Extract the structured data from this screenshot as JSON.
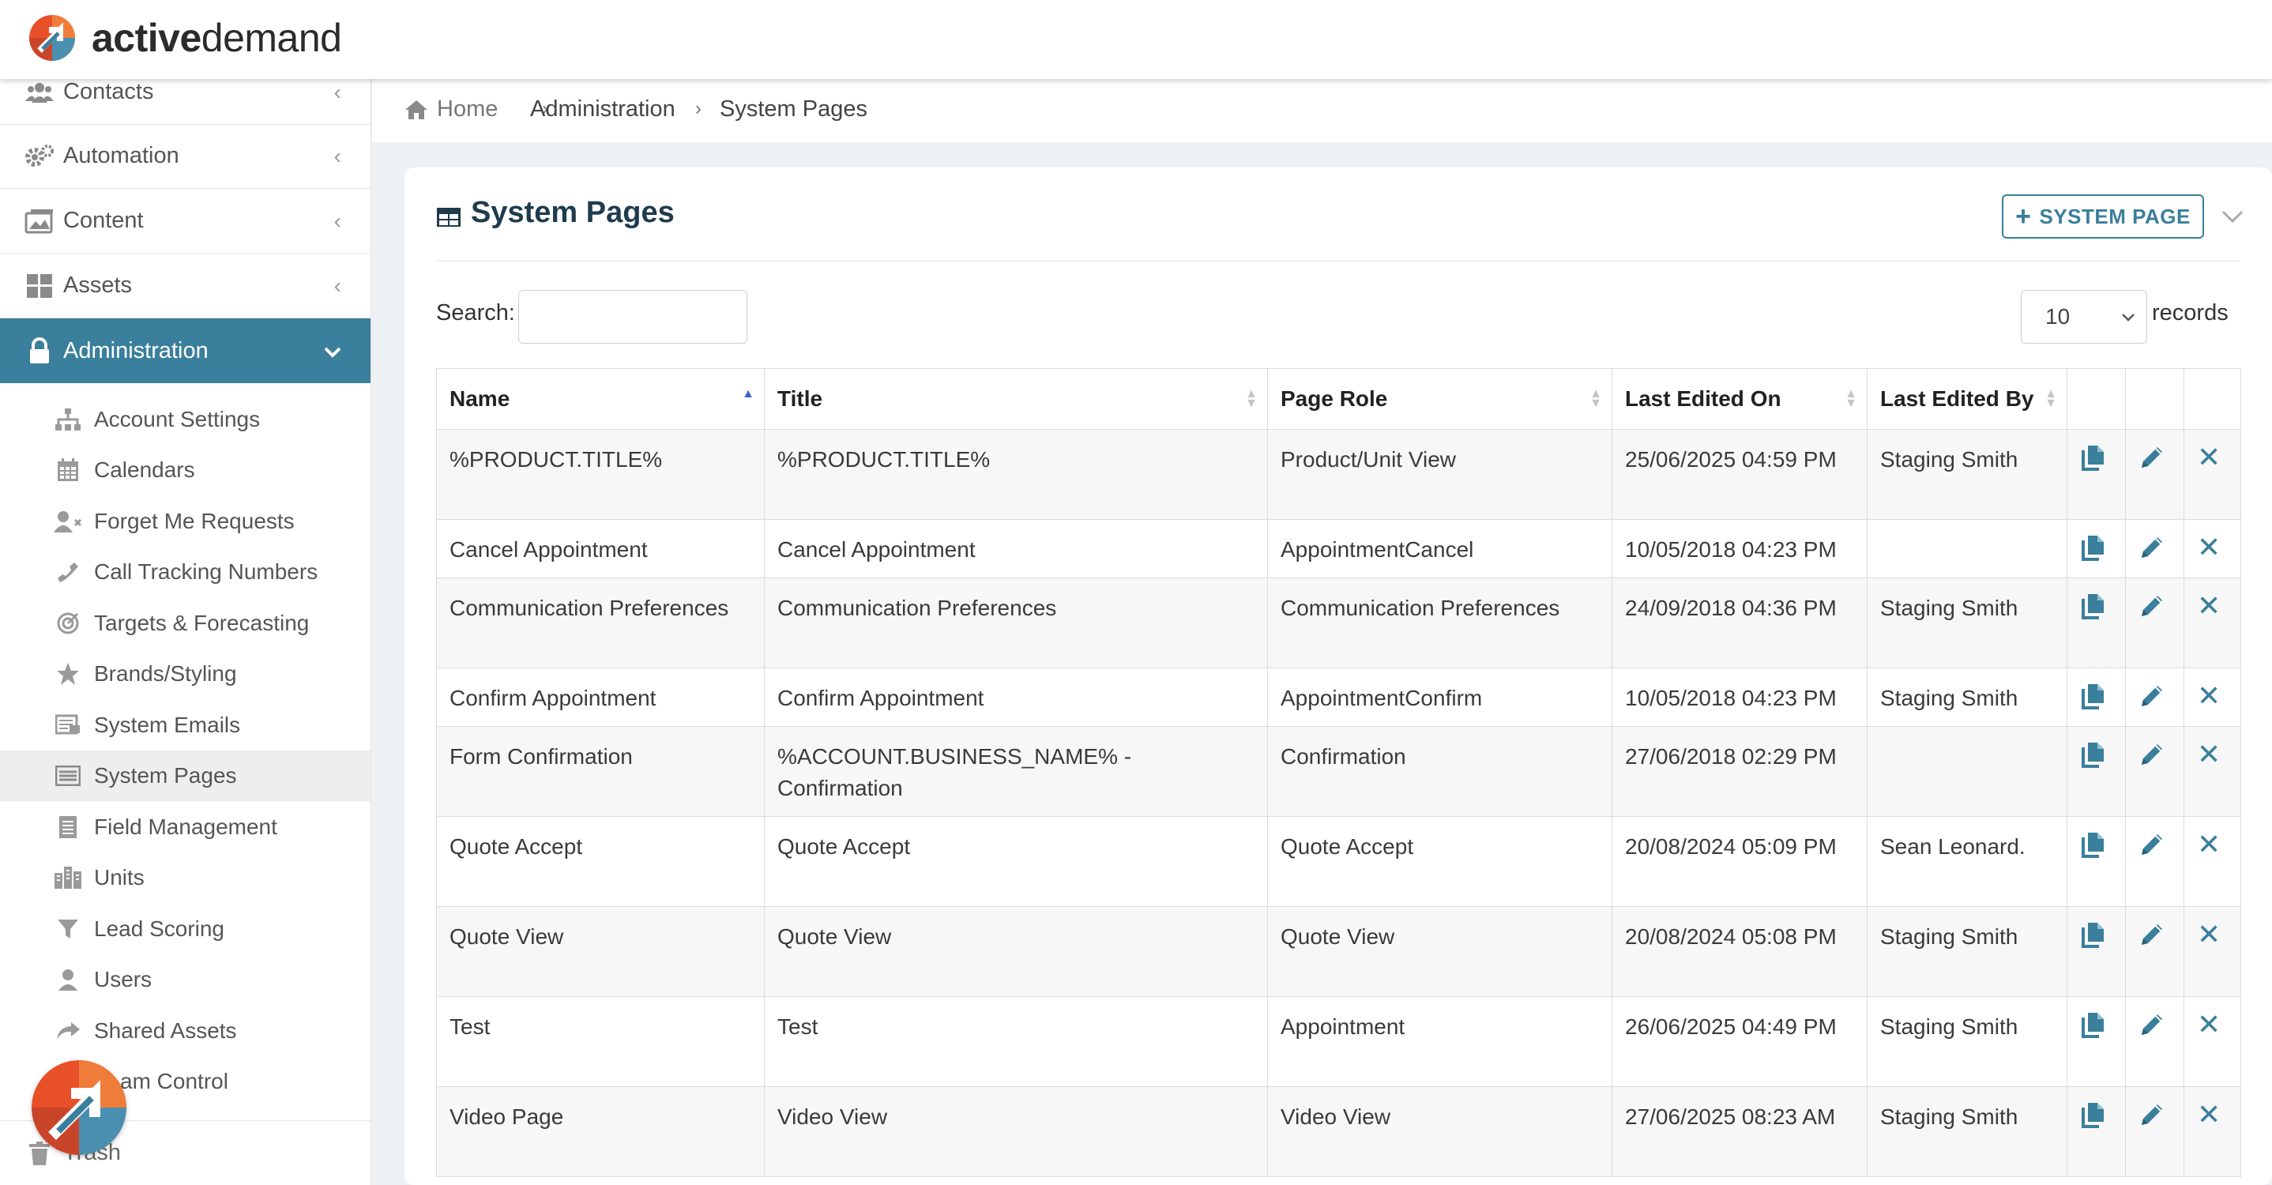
{
  "app": {
    "logo_bold": "active",
    "logo_light": "demand"
  },
  "sidebar": {
    "items": [
      {
        "label": "Contacts",
        "icon": "users-icon"
      },
      {
        "label": "Automation",
        "icon": "gears-icon"
      },
      {
        "label": "Content",
        "icon": "content-icon"
      },
      {
        "label": "Assets",
        "icon": "grid-icon"
      },
      {
        "label": "Administration",
        "icon": "lock-icon",
        "active": true
      }
    ],
    "sub_items": [
      {
        "label": "Account Settings",
        "icon": "sitemap-icon"
      },
      {
        "label": "Calendars",
        "icon": "calendar-icon"
      },
      {
        "label": "Forget Me Requests",
        "icon": "user-x-icon"
      },
      {
        "label": "Call Tracking Numbers",
        "icon": "phone-icon"
      },
      {
        "label": "Targets & Forecasting",
        "icon": "target-icon"
      },
      {
        "label": "Brands/Styling",
        "icon": "star-icon"
      },
      {
        "label": "System Emails",
        "icon": "email-icon"
      },
      {
        "label": "System Pages",
        "icon": "pages-icon",
        "current": true
      },
      {
        "label": "Field Management",
        "icon": "document-icon"
      },
      {
        "label": "Units",
        "icon": "building-icon"
      },
      {
        "label": "Lead Scoring",
        "icon": "filter-icon"
      },
      {
        "label": "Users",
        "icon": "user-icon"
      },
      {
        "label": "Shared Assets",
        "icon": "share-icon"
      },
      {
        "label": "am Control",
        "icon": "team-icon"
      }
    ],
    "trash_label": "Trash"
  },
  "breadcrumb": {
    "home": "Home",
    "level1": "Administration",
    "current": "System Pages"
  },
  "card": {
    "title": "System Pages",
    "add_button": "SYSTEM PAGE",
    "search_label": "Search:",
    "search_value": "",
    "records_value": "10",
    "records_label": "records"
  },
  "table": {
    "columns": [
      "Name",
      "Title",
      "Page Role",
      "Last Edited On",
      "Last Edited By"
    ],
    "rows": [
      {
        "name": "%PRODUCT.TITLE%",
        "title": "%PRODUCT.TITLE%",
        "role": "Product/Unit View",
        "edited_on": "25/06/2025 04:59 PM",
        "edited_by": "Staging Smith"
      },
      {
        "name": "Cancel Appointment",
        "title": "Cancel Appointment",
        "role": "AppointmentCancel",
        "edited_on": "10/05/2018 04:23 PM",
        "edited_by": ""
      },
      {
        "name": "Communication Preferences",
        "title": "Communication Preferences",
        "role": "Communication Preferences",
        "edited_on": "24/09/2018 04:36 PM",
        "edited_by": "Staging Smith"
      },
      {
        "name": "Confirm Appointment",
        "title": "Confirm Appointment",
        "role": "AppointmentConfirm",
        "edited_on": "10/05/2018 04:23 PM",
        "edited_by": "Staging Smith"
      },
      {
        "name": "Form Confirmation",
        "title": "%ACCOUNT.BUSINESS_NAME% - Confirmation",
        "role": "Confirmation",
        "edited_on": "27/06/2018 02:29 PM",
        "edited_by": ""
      },
      {
        "name": "Quote Accept",
        "title": "Quote Accept",
        "role": "Quote Accept",
        "edited_on": "20/08/2024 05:09 PM",
        "edited_by": "Sean Leonard."
      },
      {
        "name": "Quote View",
        "title": "Quote View",
        "role": "Quote View",
        "edited_on": "20/08/2024 05:08 PM",
        "edited_by": "Staging Smith"
      },
      {
        "name": "Test",
        "title": "Test",
        "role": "Appointment",
        "edited_on": "26/06/2025 04:49 PM",
        "edited_by": "Staging Smith"
      },
      {
        "name": "Video Page",
        "title": "Video View",
        "role": "Video View",
        "edited_on": "27/06/2025 08:23 AM",
        "edited_by": "Staging Smith"
      }
    ]
  },
  "colors": {
    "brand": "#3a7f9b",
    "title": "#1f3b4d",
    "logo_orange": "#e8502a",
    "logo_blue": "#4a8fb0"
  }
}
